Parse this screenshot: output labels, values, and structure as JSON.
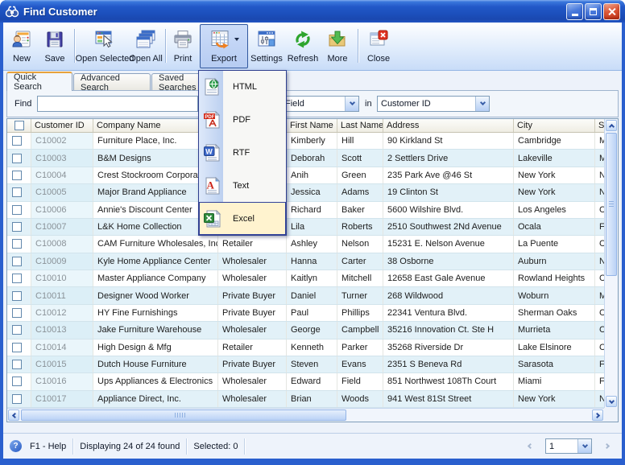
{
  "window": {
    "title": "Find Customer"
  },
  "toolbar": {
    "buttons": [
      {
        "label": "New",
        "icon": "new-customer-icon"
      },
      {
        "label": "Save",
        "icon": "save-icon"
      },
      {
        "label": "Open Selected",
        "icon": "open-selected-icon"
      },
      {
        "label": "Open All",
        "icon": "open-all-icon"
      },
      {
        "label": "Print",
        "icon": "print-icon"
      },
      {
        "label": "Export",
        "icon": "export-icon",
        "pressed": true,
        "has_dropdown": true
      },
      {
        "label": "Settings",
        "icon": "settings-icon"
      },
      {
        "label": "Refresh",
        "icon": "refresh-icon"
      },
      {
        "label": "More",
        "icon": "more-icon"
      },
      {
        "label": "Close",
        "icon": "close-window-icon"
      }
    ]
  },
  "tabs": [
    {
      "label": "Quick Search",
      "active": true
    },
    {
      "label": "Advanced Search",
      "active": false
    },
    {
      "label": "Saved Searches",
      "active": false
    }
  ],
  "search": {
    "find_label": "Find",
    "find_value": "",
    "field_combo_value": "Any Field",
    "in_label": "in",
    "column_combo_value": "Customer ID"
  },
  "export_menu": {
    "items": [
      {
        "label": "HTML",
        "icon": "html-file-icon",
        "highlighted": false
      },
      {
        "label": "PDF",
        "icon": "pdf-file-icon",
        "highlighted": false
      },
      {
        "label": "RTF",
        "icon": "rtf-file-icon",
        "highlighted": false
      },
      {
        "label": "Text",
        "icon": "text-file-icon",
        "highlighted": false
      },
      {
        "label": "Excel",
        "icon": "excel-file-icon",
        "highlighted": true
      }
    ]
  },
  "table": {
    "headers": [
      "Customer ID",
      "Company Name",
      "",
      "First Name",
      "Last Name",
      "Address",
      "City",
      "St"
    ],
    "rows": [
      [
        "C10002",
        "Furniture Place, Inc.",
        "",
        "Kimberly",
        "Hill",
        "90 Kirkland St",
        "Cambridge",
        "MA"
      ],
      [
        "C10003",
        "B&M Designs",
        "",
        "Deborah",
        "Scott",
        "2 Settlers Drive",
        "Lakeville",
        "MA"
      ],
      [
        "C10004",
        "Crest Stockroom Corporation",
        "",
        "Anih",
        "Green",
        "235 Park Ave @46 St",
        "New York",
        "NY"
      ],
      [
        "C10005",
        "Major Brand Appliance",
        "",
        "Jessica",
        "Adams",
        "19 Clinton St",
        "New York",
        "NY"
      ],
      [
        "C10006",
        "Annie's Discount Center",
        "",
        "Richard",
        "Baker",
        "5600 Wilshire Blvd.",
        "Los Angeles",
        "CA"
      ],
      [
        "C10007",
        "L&K Home Collection",
        "",
        "Lila",
        "Roberts",
        "2510 Southwest 2Nd Avenue",
        "Ocala",
        "FL"
      ],
      [
        "C10008",
        "CAM Furniture Wholesales, Inc.",
        "Retailer",
        "Ashley",
        "Nelson",
        "15231 E. Nelson Avenue",
        "La Puente",
        "CA"
      ],
      [
        "C10009",
        "Kyle Home Appliance Center",
        "Wholesaler",
        "Hanna",
        "Carter",
        "38 Osborne",
        "Auburn",
        "NY"
      ],
      [
        "C10010",
        "Master Appliance Company",
        "Wholesaler",
        "Kaitlyn",
        "Mitchell",
        "12658 East Gale Avenue",
        "Rowland Heights",
        "CA"
      ],
      [
        "C10011",
        "Designer Wood Worker",
        "Private Buyer",
        "Daniel",
        "Turner",
        "268 Wildwood",
        "Woburn",
        "MA"
      ],
      [
        "C10012",
        "HY Fine Furnishings",
        "Private Buyer",
        "Paul",
        "Phillips",
        "22341 Ventura Blvd.",
        "Sherman Oaks",
        "CA"
      ],
      [
        "C10013",
        "Jake Furniture Warehouse",
        "Wholesaler",
        "George",
        "Campbell",
        "35216 Innovation Ct. Ste H",
        "Murrieta",
        "CA"
      ],
      [
        "C10014",
        "High Design & Mfg",
        "Retailer",
        "Kenneth",
        "Parker",
        "35268 Riverside Dr",
        "Lake Elsinore",
        "CA"
      ],
      [
        "C10015",
        "Dutch House Furniture",
        "Private Buyer",
        "Steven",
        "Evans",
        "2351 S Beneva Rd",
        "Sarasota",
        "FL"
      ],
      [
        "C10016",
        "Ups Appliances & Electronics",
        "Wholesaler",
        "Edward",
        "Field",
        "851 Northwest 108Th Court",
        "Miami",
        "FL"
      ],
      [
        "C10017",
        "Appliance Direct, Inc.",
        "Wholesaler",
        "Brian",
        "Woods",
        "941 West 81St Street",
        "New York",
        "NY"
      ]
    ]
  },
  "statusbar": {
    "help": "F1 - Help",
    "displaying": "Displaying 24 of 24 found",
    "selected": "Selected: 0",
    "page": "1"
  }
}
